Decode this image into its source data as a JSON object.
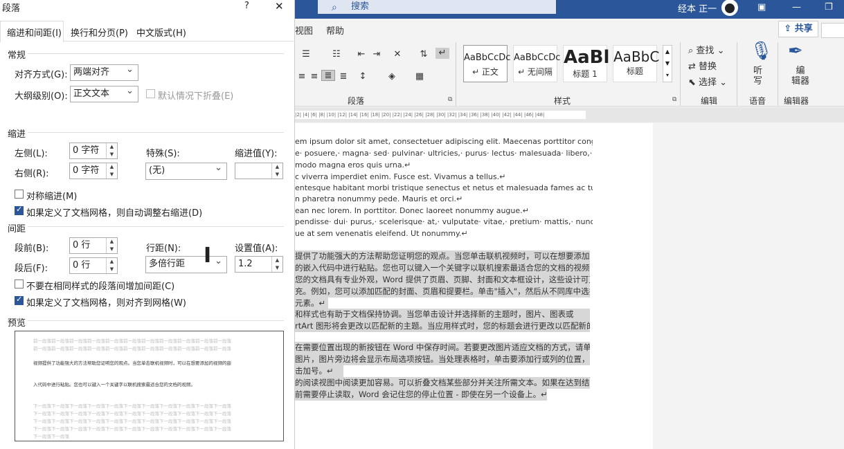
{
  "dialog": {
    "title": "段落",
    "help": "?",
    "close": "✕",
    "tabs": [
      "缩进和间距(I)",
      "换行和分页(P)",
      "中文版式(H)"
    ],
    "general": {
      "header": "常规",
      "align_label": "对齐方式(G):",
      "align_value": "两端对齐",
      "outline_label": "大纲级别(O):",
      "outline_value": "正文文本",
      "collapse_label": "默认情况下折叠(E)"
    },
    "indent": {
      "header": "缩进",
      "left_label": "左侧(L):",
      "left_value": "0 字符",
      "right_label": "右侧(R):",
      "right_value": "0 字符",
      "special_label": "特殊(S):",
      "special_value": "(无)",
      "by_label": "缩进值(Y):",
      "by_value": "",
      "mirror_label": "对称缩进(M)",
      "auto_label": "如果定义了文档网格，则自动调整右缩进(D)"
    },
    "spacing": {
      "header": "间距",
      "before_label": "段前(B):",
      "before_value": "0 行",
      "after_label": "段后(F):",
      "after_value": "0 行",
      "line_label": "行距(N):",
      "line_value": "多倍行距",
      "at_label": "设置值(A):",
      "at_value": "1.2",
      "no_space_label": "不要在相同样式的段落间增加间距(C)",
      "snap_label": "如果定义了文档网格，则对齐到网格(W)"
    },
    "preview": {
      "header": "预览",
      "prev_lines": [
        "前一段落前一段落前一段落前一段落前一段落前一段落前一段落前一段落前一段落前一段落前一段落",
        "前一段落前一段落前一段落前一段落前一段落前一段落前一段落前一段落前一段落前一段落前一段落"
      ],
      "cur_lines": [
        "视频提供了功能强大的方法帮助您证明您的观点。当您单击联机视频时，可以在想要添加的视频的嵌",
        "入代码中进行粘贴。您也可以键入一个关键字以联机搜索最适合您的文档的视频。"
      ],
      "next_lines": [
        "下一段落下一段落下一段落下一段落下一段落下一段落下一段落下一段落下一段落下一段落下一段落",
        "下一段落下一段落下一段落下一段落下一段落下一段落下一段落下一段落下一段落下一段落下一段落",
        "下一段落下一段落下一段落下一段落下一段落下一段落下一段落下一段落下一段落下一段落下一段落",
        "下一段落下一段落下一段落下一段落下一段落下一段落下一段落下一段落下一段落下一段落下一段落",
        "下一段落下一段落"
      ]
    }
  },
  "word": {
    "search_placeholder": "搜索",
    "user": "经本 正一",
    "tabs": [
      "视图",
      "帮助"
    ],
    "share": "共享",
    "groups": {
      "paragraph": "段落",
      "styles": "样式",
      "editing": "编辑",
      "voice": "语音",
      "editor": "编辑器"
    },
    "styles": [
      {
        "sample": "AaBbCcDc",
        "label": "↵ 正文"
      },
      {
        "sample": "AaBbCcDc",
        "label": "↵ 无间隔"
      },
      {
        "sample": "AaBl",
        "label": "标题 1"
      },
      {
        "sample": "AaBbC",
        "label": "标题"
      }
    ],
    "edit": {
      "find": "查找",
      "replace": "替换",
      "select": "选择"
    },
    "voice_btn": "听\n写",
    "editor_btn": "编\n辑器",
    "ruler": "|2| |4| |6| |8| |10| |12| |14| |16| |18| |20| |22| |24| |26| |28| |30| |32| |34| |36| |38| |40| |42| |44| |46| |48|",
    "latin": [
      "em ipsum dolor sit amet, consectetuer adipiscing elit. Maecenas porttitor congue massa.",
      "e· posuere,· magna· sed· pulvinar· ultricies,· purus· lectus· malesuada· libero,· sit· amet",
      "modo magna eros quis urna.↵",
      "c viverra imperdiet enim. Fusce est. Vivamus a tellus.↵",
      "entesque habitant morbi tristique senectus et netus et malesuada fames ac turpis egestas.",
      "n pharetra nonummy pede. Mauris et orci.↵",
      "ean nec lorem. In porttitor. Donec laoreet nonummy augue.↵",
      "pendisse· dui· purus,· scelerisque· at,· vulputate· vitae,· pretium· mattis,· nunc.· Mauris· eget",
      "ue at sem venenatis eleifend. Ut nonummy.↵"
    ],
    "chinese": [
      "提供了功能强大的方法帮助您证明您的观点。当您单击联机视频时，可以在想要添加的",
      "的嵌入代码中进行粘贴。您也可以键入一个关键字以联机搜索最适合您的文档的视频。↵",
      "您的文档具有专业外观，Word 提供了页眉、页脚、封面和文本框设计，这些设计可互",
      "充。例如，您可以添加匹配的封面、页眉和提要栏。单击\"插入\"，然后从不同库中选择",
      "元素。↵",
      "和样式也有助于文档保持协调。当您单击设计并选择新的主题时，图片、图表或",
      "rtArt 图形将会更改以匹配新的主题。当应用样式时，您的标题会进行更改以匹配新的",
      "在需要位置出现的新按钮在 Word 中保存时间。若要更改图片适应文档的方式，请单",
      "图片，图片旁边将会显示布局选项按钮。当处理表格时，单击要添加行或列的位置，然",
      "击加号。↵",
      "的阅读视图中阅读更加容易。可以折叠文档某些部分并关注所需文本。如果在达到结尾",
      "前需要停止读取，Word 会记住您的停止位置 - 即使在另一个设备上。↵"
    ]
  }
}
